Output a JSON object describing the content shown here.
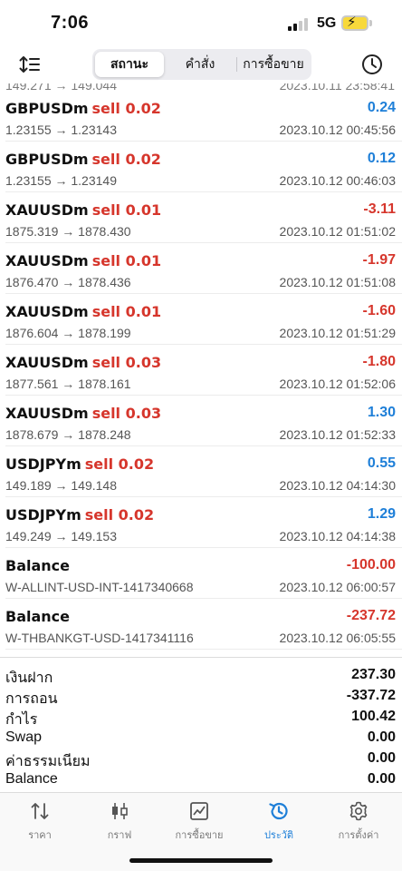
{
  "status": {
    "time": "7:06",
    "network": "5G"
  },
  "toolbar": {
    "tabs": [
      {
        "label": "สถานะ",
        "active": true
      },
      {
        "label": "คำสั่ง",
        "active": false
      },
      {
        "label": "การซื้อขาย",
        "active": false
      }
    ]
  },
  "partial_row": {
    "prices": "149.271 → 149.044",
    "time": "2023.10.11 23:58:41"
  },
  "deals": [
    {
      "symbol": "GBPUSDm",
      "side": "sell 0.02",
      "profit": "0.24",
      "positive": true,
      "prices": "1.23155 → 1.23143",
      "time": "2023.10.12 00:45:56"
    },
    {
      "symbol": "GBPUSDm",
      "side": "sell 0.02",
      "profit": "0.12",
      "positive": true,
      "prices": "1.23155 → 1.23149",
      "time": "2023.10.12 00:46:03"
    },
    {
      "symbol": "XAUUSDm",
      "side": "sell 0.01",
      "profit": "-3.11",
      "positive": false,
      "prices": "1875.319 → 1878.430",
      "time": "2023.10.12 01:51:02"
    },
    {
      "symbol": "XAUUSDm",
      "side": "sell 0.01",
      "profit": "-1.97",
      "positive": false,
      "prices": "1876.470 → 1878.436",
      "time": "2023.10.12 01:51:08"
    },
    {
      "symbol": "XAUUSDm",
      "side": "sell 0.01",
      "profit": "-1.60",
      "positive": false,
      "prices": "1876.604 → 1878.199",
      "time": "2023.10.12 01:51:29"
    },
    {
      "symbol": "XAUUSDm",
      "side": "sell 0.03",
      "profit": "-1.80",
      "positive": false,
      "prices": "1877.561 → 1878.161",
      "time": "2023.10.12 01:52:06"
    },
    {
      "symbol": "XAUUSDm",
      "side": "sell 0.03",
      "profit": "1.30",
      "positive": true,
      "prices": "1878.679 → 1878.248",
      "time": "2023.10.12 01:52:33"
    },
    {
      "symbol": "USDJPYm",
      "side": "sell 0.02",
      "profit": "0.55",
      "positive": true,
      "prices": "149.189 → 149.148",
      "time": "2023.10.12 04:14:30"
    },
    {
      "symbol": "USDJPYm",
      "side": "sell 0.02",
      "profit": "1.29",
      "positive": true,
      "prices": "149.249 → 149.153",
      "time": "2023.10.12 04:14:38"
    },
    {
      "symbol": "Balance",
      "side": "",
      "profit": "-100.00",
      "positive": false,
      "prices": "W-ALLINT-USD-INT-1417340668",
      "time": "2023.10.12 06:00:57"
    },
    {
      "symbol": "Balance",
      "side": "",
      "profit": "-237.72",
      "positive": false,
      "prices": "W-THBANKGT-USD-1417341116",
      "time": "2023.10.12 06:05:55"
    }
  ],
  "summary": [
    {
      "label": "เงินฝาก",
      "value": "237.30"
    },
    {
      "label": "การถอน",
      "value": "-337.72"
    },
    {
      "label": "กำไร",
      "value": "100.42"
    },
    {
      "label": "Swap",
      "value": "0.00"
    },
    {
      "label": "ค่าธรรมเนียม",
      "value": "0.00"
    },
    {
      "label": "Balance",
      "value": "0.00"
    }
  ],
  "tabbar": [
    {
      "label": "ราคา",
      "icon": "quotes-icon",
      "active": false
    },
    {
      "label": "กราฟ",
      "icon": "chart-icon",
      "active": false
    },
    {
      "label": "การซื้อขาย",
      "icon": "trade-icon",
      "active": false
    },
    {
      "label": "ประวัติ",
      "icon": "history-icon",
      "active": true
    },
    {
      "label": "การตั้งค่า",
      "icon": "settings-icon",
      "active": false
    }
  ],
  "colors": {
    "positive": "#1e7fd8",
    "negative": "#d6362c",
    "accent": "#1e7fd8"
  }
}
